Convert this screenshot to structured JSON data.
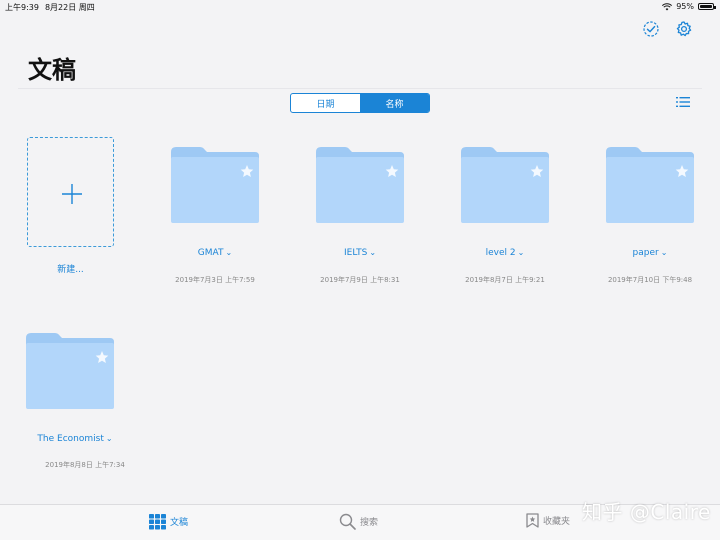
{
  "status_bar": {
    "time": "上午9:39",
    "date": "8月22日 周四",
    "battery": "95%"
  },
  "page": {
    "title": "文稿"
  },
  "segmented": {
    "date_label": "日期",
    "name_label": "名称"
  },
  "new_item": {
    "label": "新建..."
  },
  "folders": [
    {
      "name": "GMAT",
      "date": "2019年7月3日 上午7:59"
    },
    {
      "name": "IELTS",
      "date": "2019年7月9日 上午8:31"
    },
    {
      "name": "level 2",
      "date": "2019年8月7日 上午9:21"
    },
    {
      "name": "paper",
      "date": "2019年7月10日 下午9:48"
    },
    {
      "name": "The Economist",
      "date": "2019年8月8日 上午7:34"
    }
  ],
  "tabbar": {
    "docs": "文稿",
    "search": "搜索",
    "favorites": "收藏夹"
  },
  "watermark": "知乎 @Claire",
  "colors": {
    "accent": "#1b84d6",
    "folder": "#b2d6fa",
    "folder_tab": "#9ec9f4"
  }
}
